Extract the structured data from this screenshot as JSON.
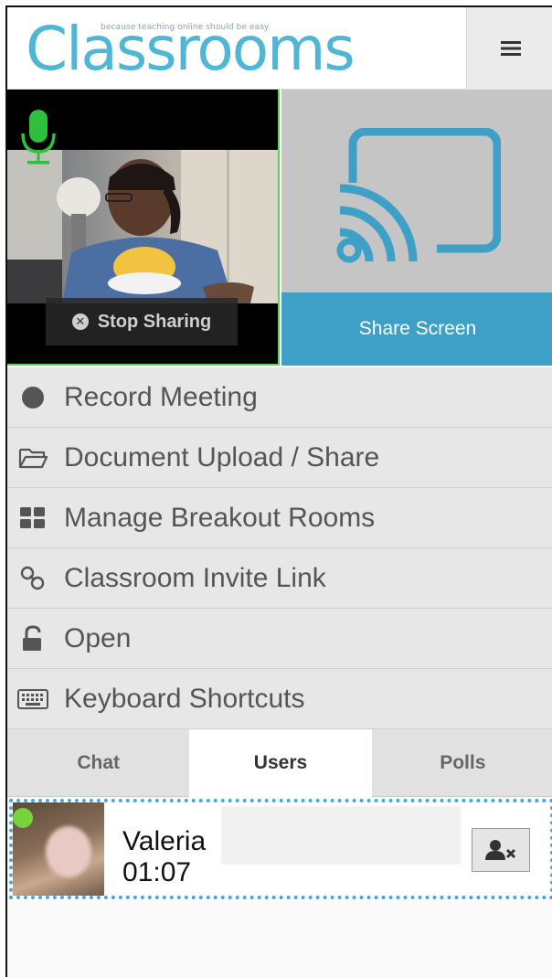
{
  "header": {
    "logo_text": "Classrooms",
    "tagline": "because teaching online should be easy",
    "menu_icon": "hamburger-icon"
  },
  "video": {
    "mic_icon": "microphone-icon",
    "stop_sharing_label": "Stop Sharing"
  },
  "share": {
    "icon": "cast-icon",
    "label": "Share Screen"
  },
  "menu": {
    "items": [
      {
        "label": "Record Meeting",
        "icon": "record-icon"
      },
      {
        "label": "Document Upload / Share",
        "icon": "folder-icon"
      },
      {
        "label": "Manage Breakout Rooms",
        "icon": "grid-icon"
      },
      {
        "label": "Classroom Invite Link",
        "icon": "link-icon"
      },
      {
        "label": "Open",
        "icon": "unlock-icon"
      },
      {
        "label": "Keyboard Shortcuts",
        "icon": "keyboard-icon"
      }
    ]
  },
  "tabs": [
    {
      "label": "Chat",
      "active": false
    },
    {
      "label": "Users",
      "active": true
    },
    {
      "label": "Polls",
      "active": false
    }
  ],
  "user": {
    "name": "Valeria",
    "time": "01:07",
    "status": "online",
    "kick_icon": "remove-user-icon"
  },
  "colors": {
    "brand": "#4fb6d6",
    "share_button": "#3ea0c6",
    "mic_active": "#5fd25a",
    "online": "#76d33a"
  }
}
